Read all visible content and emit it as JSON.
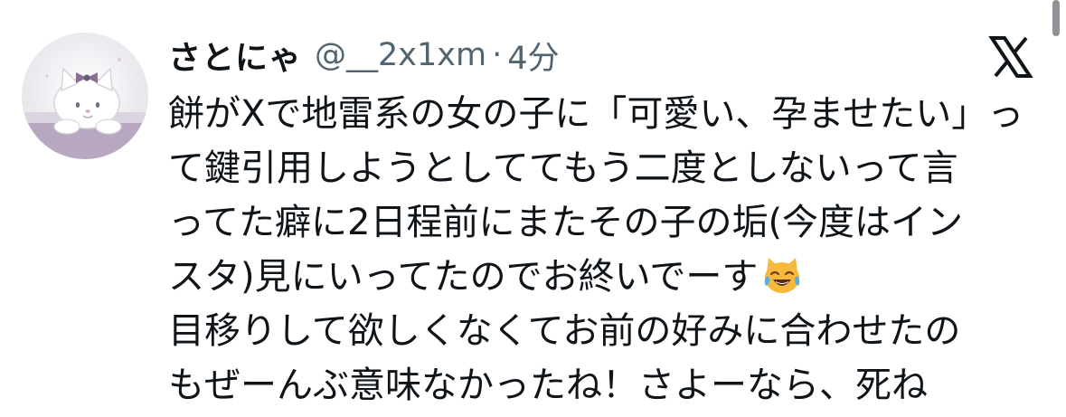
{
  "tweet": {
    "display_name": "さとにゃ",
    "handle": "@__2x1xm",
    "separator": "·",
    "time": "4分",
    "lines": [
      "餅がXで地雷系の女の子に「可愛い、孕ませたい」っ",
      "て鍵引用しようとしててもう二度としないって言",
      "ってた癖に2日程前にまたその子の垢(今度はイン",
      "スタ)見にいってたのでお終いでーす",
      "目移りして欲しくなくてお前の好みに合わせたの",
      "もぜーんぶ意味なかったね！さよーなら、死ね"
    ],
    "emoji_name": "cat-tears-of-joy-emoji"
  },
  "icons": {
    "avatar": "hello-kitty-avatar",
    "brand": "x-logo-icon"
  },
  "colors": {
    "text": "#0f1419",
    "secondary": "#536471",
    "avatar_bg": "#f1eef3",
    "avatar_band": "#b8a7c1"
  }
}
